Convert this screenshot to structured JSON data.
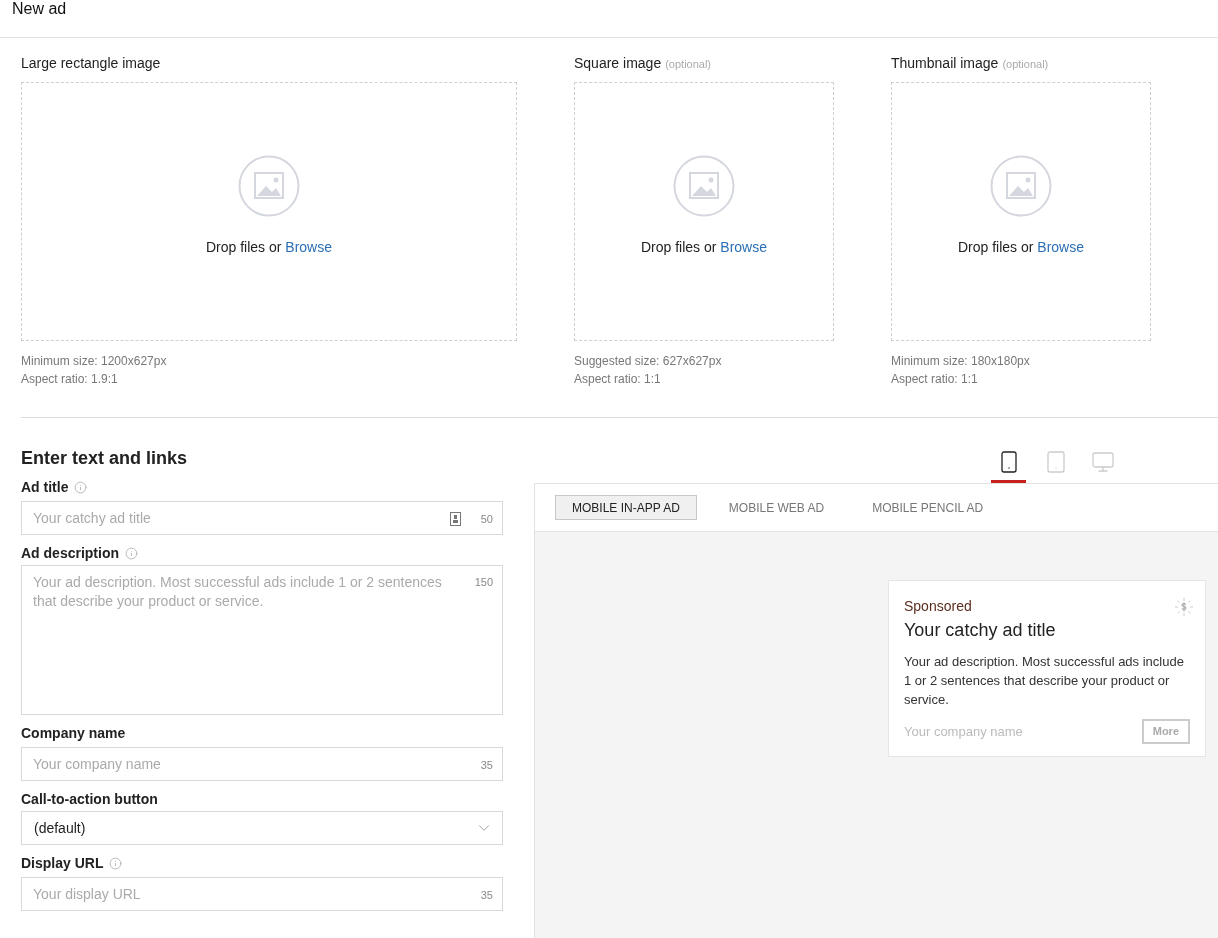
{
  "header": {
    "title": "New ad"
  },
  "upload": {
    "slots": [
      {
        "label": "Large rectangle image",
        "drop_text": "Drop files or",
        "browse": "Browse",
        "notes": [
          "Minimum size: 1200x627px",
          "Aspect ratio: 1.9:1"
        ]
      },
      {
        "label": "Square image",
        "optional": "(optional)",
        "drop_text": "Drop files or",
        "browse": "Browse",
        "notes": [
          "Suggested size: 627x627px",
          "Aspect ratio: 1:1"
        ]
      },
      {
        "label": "Thumbnail image",
        "optional": "(optional)",
        "drop_text": "Drop files or",
        "browse": "Browse",
        "notes": [
          "Minimum size: 180x180px",
          "Aspect ratio: 1:1"
        ]
      }
    ]
  },
  "text_section": {
    "heading": "Enter text and links",
    "fields": [
      {
        "kind": "text",
        "label": "Ad title",
        "info": true,
        "placeholder": "Your catchy ad title",
        "counter": "50",
        "counter_icon": true
      },
      {
        "kind": "textarea",
        "label": "Ad description",
        "info": true,
        "placeholder": "Your ad description. Most successful ads include 1 or 2 sentences that describe your product or service.",
        "counter": "150",
        "counter_icon": false
      },
      {
        "kind": "text",
        "label": "Company name",
        "info": false,
        "placeholder": "Your company name",
        "counter": "35",
        "counter_icon": false
      },
      {
        "kind": "select",
        "label": "Call-to-action button",
        "info": false,
        "value": "(default)"
      },
      {
        "kind": "text",
        "label": "Display URL",
        "info": true,
        "placeholder": "Your display URL",
        "counter": "35",
        "counter_icon": false
      }
    ]
  },
  "preview": {
    "devices": [
      {
        "kind": "phone",
        "selected": true
      },
      {
        "kind": "tablet",
        "selected": false
      },
      {
        "kind": "desktop",
        "selected": false
      }
    ],
    "tabs": [
      {
        "label": "MOBILE IN-APP AD",
        "selected": true
      },
      {
        "label": "MOBILE WEB AD",
        "selected": false
      },
      {
        "label": "MOBILE PENCIL AD",
        "selected": false
      }
    ],
    "ad": {
      "sponsored": "Sponsored",
      "title": "Your catchy ad title",
      "description": "Your ad description. Most successful ads include 1 or 2 sentences that describe your product or service.",
      "company": "Your company name",
      "button": "More"
    }
  }
}
